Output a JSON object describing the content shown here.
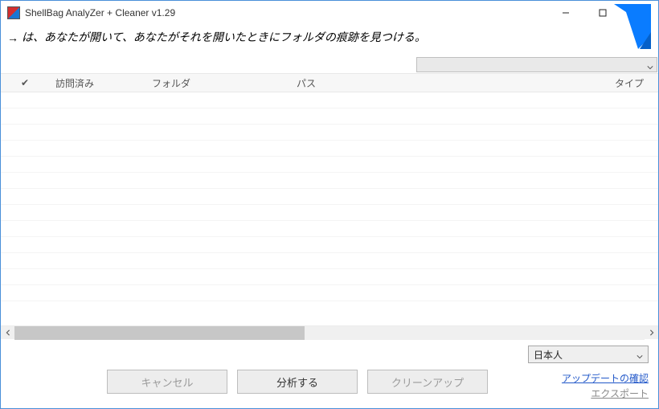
{
  "titlebar": {
    "title": "ShellBag AnalyZer + Cleaner v1.29"
  },
  "description": {
    "arrow": "→",
    "text": "は、あなたが開いて、あなたがそれを開いたときにフォルダの痕跡を見つける。"
  },
  "columns": {
    "check": "✔",
    "visited": "訪問済み",
    "folder": "フォルダ",
    "path": "パス",
    "type": "タイプ"
  },
  "language": {
    "selected": "日本人"
  },
  "buttons": {
    "cancel": "キャンセル",
    "analyze": "分析する",
    "cleanup": "クリーンアップ"
  },
  "links": {
    "update": "アップデートの確認",
    "export": "エクスポート"
  }
}
